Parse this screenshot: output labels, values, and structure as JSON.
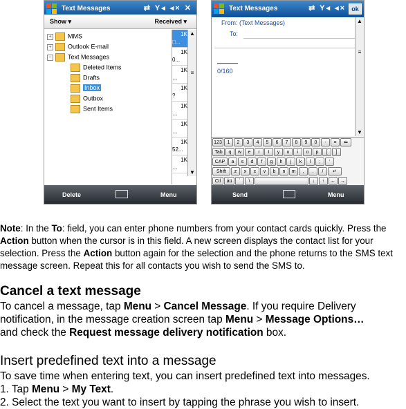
{
  "phone1": {
    "title": "Text Messages",
    "show_label": "Show ▾",
    "sort_label": "Received ▾",
    "tree": [
      {
        "label": "MMS"
      },
      {
        "label": "Outlook E-mail"
      },
      {
        "label": "Text Messages"
      },
      {
        "label": "Deleted Items"
      },
      {
        "label": "Drafts"
      },
      {
        "label": "Inbox"
      },
      {
        "label": "Outbox"
      },
      {
        "label": "Sent Items"
      }
    ],
    "sizes": [
      {
        "k": "1K",
        "t": "□..."
      },
      {
        "k": "1K",
        "t": "0..."
      },
      {
        "k": "1K",
        "t": "…"
      },
      {
        "k": "1K",
        "t": "?"
      },
      {
        "k": "1K",
        "t": "…"
      },
      {
        "k": "1K",
        "t": "…"
      },
      {
        "k": "1K",
        "t": "52..."
      },
      {
        "k": "1K",
        "t": "…"
      }
    ],
    "left_soft": "Delete",
    "right_soft": "Menu"
  },
  "phone2": {
    "title": "Text Messages",
    "ok": "ok",
    "from": "From: (Text Messages)",
    "to": "To:",
    "counter": "0/160",
    "keyboard": [
      [
        "123",
        "1",
        "2",
        "3",
        "4",
        "5",
        "6",
        "7",
        "8",
        "9",
        "0",
        "-",
        "=",
        "⬅"
      ],
      [
        "Tab",
        "q",
        "w",
        "e",
        "r",
        "t",
        "y",
        "u",
        "i",
        "o",
        "p",
        "[",
        "]"
      ],
      [
        "CAP",
        "a",
        "s",
        "d",
        "f",
        "g",
        "h",
        "j",
        "k",
        "l",
        ";",
        "'"
      ],
      [
        "Shift",
        "z",
        "x",
        "c",
        "v",
        "b",
        "n",
        "m",
        ",",
        ".",
        "/",
        "↵"
      ],
      [
        "Ctl",
        "áü",
        "`",
        "\\",
        " ",
        "↓",
        "↑",
        "←",
        "→"
      ]
    ],
    "left_soft": "Send",
    "right_soft": "Menu"
  },
  "note": {
    "p1": "Note",
    "p2": ": In the ",
    "p3": "To",
    "p4": ": field, you can enter phone numbers from your contact cards quickly. Press the ",
    "p5": "Action",
    "p6": " button when the cursor is in this field. A new screen displays the contact list for your selection. Press the ",
    "p7": "Action",
    "p8": " button again for the selection and the phone returns to the SMS text message screen. Repeat this for all contacts you wish to send the SMS to."
  },
  "cancel": {
    "heading": "Cancel a text message",
    "l1a": "To cancel a message, tap ",
    "l1b": "Menu",
    "l1c": " > ",
    "l1d": "Cancel Message",
    "l1e": ". If you require Delivery",
    "l2a": "notification, in the message creation screen tap ",
    "l2b": "Menu",
    "l2c": " > ",
    "l2d": "Message Options…",
    "l3a": "and check the ",
    "l3b": "Request message delivery notification",
    "l3c": " box."
  },
  "insert": {
    "heading": "Insert predefined text into a message",
    "l1": "To save time when entering text, you can insert predefined text into messages.",
    "l2a": "1. Tap ",
    "l2b": "Menu",
    "l2c": " > ",
    "l2d": "My Text",
    "l2e": ".",
    "l3": "2. Select the text you want to insert by tapping the phrase you wish to insert."
  }
}
